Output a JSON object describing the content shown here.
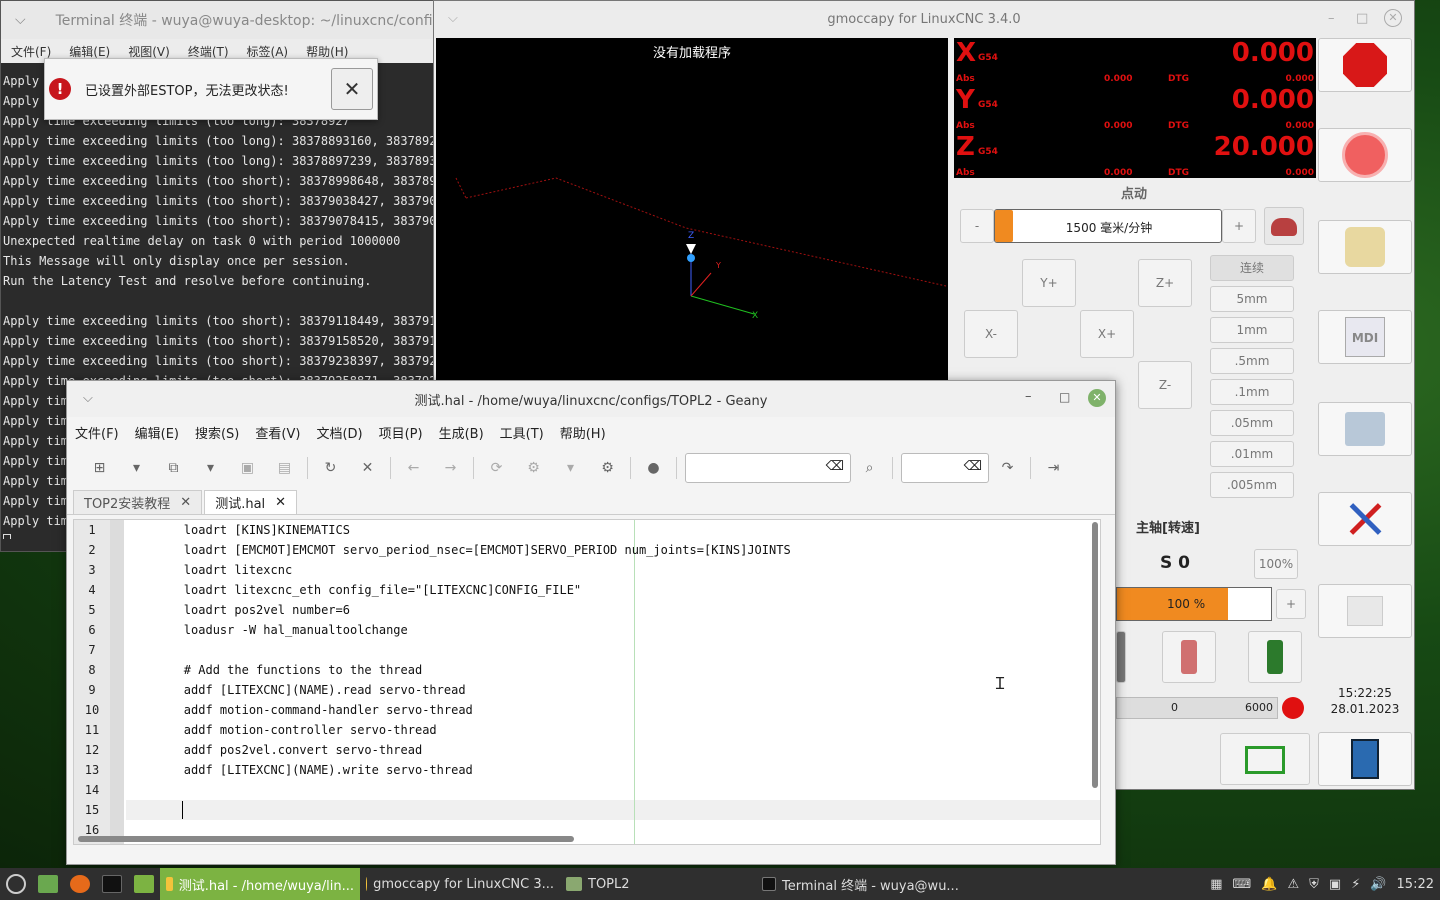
{
  "terminal": {
    "title": "Terminal 终端 - wuya@wuya-desktop: ~/linuxcnc/configs/TO",
    "menu": [
      "文件(F)",
      "编辑(E)",
      "视图(V)",
      "终端(T)",
      "标签(A)",
      "帮助(H)"
    ],
    "lines": [
      "Apply time exceeding limits (too long): 38378923",
      "Apply time exceeding limits (too long): 38378925",
      "Apply time exceeding limits (too long): 38378927",
      "Apply time exceeding limits (too long): 38378893160, 38378929",
      "Apply time exceeding limits (too long): 38378897239, 38378934",
      "Apply time exceeding limits (too short): 38378998648, 38378993",
      "Apply time exceeding limits (too short): 38379038427, 38379033",
      "Apply time exceeding limits (too short): 38379078415, 38379073",
      "Unexpected realtime delay on task 0 with period 1000000",
      "This Message will only display once per session.",
      "Run the Latency Test and resolve before continuing.",
      "",
      "Apply time exceeding limits (too short): 38379118449, 38379113",
      "Apply time exceeding limits (too short): 38379158520, 38379153",
      "Apply time exceeding limits (too short): 38379238397, 38379233",
      "Apply time exceeding limits (too short): 38379258871, 38379253",
      "Apply tim",
      "Apply tim",
      "Apply tim",
      "Apply tim",
      "Apply tim",
      "Apply tim",
      "Apply tim"
    ]
  },
  "alert": {
    "message": "已设置外部ESTOP，无法更改状态!",
    "icon": "error-icon",
    "close": "✕"
  },
  "gmoccapy": {
    "title": "gmoccapy for LinuxCNC  3.4.0",
    "preview_label": "没有加载程序",
    "dro": [
      {
        "axis": "X",
        "coord": "G54",
        "value": "0.000",
        "abs_label": "Abs",
        "abs": "0.000",
        "dtg_label": "DTG",
        "dtg": "0.000"
      },
      {
        "axis": "Y",
        "coord": "G54",
        "value": "0.000",
        "abs_label": "Abs",
        "abs": "0.000",
        "dtg_label": "DTG",
        "dtg": "0.000"
      },
      {
        "axis": "Z",
        "coord": "G54",
        "value": "20.000",
        "abs_label": "Abs",
        "abs": "0.000",
        "dtg_label": "DTG",
        "dtg": "0.000"
      }
    ],
    "jog": {
      "title": "点动",
      "minus": "-",
      "plus": "+",
      "speed": "1500 毫米/分钟",
      "speed_fraction": 0.08,
      "buttons": {
        "yp": "Y+",
        "zp": "Z+",
        "xm": "X-",
        "xp": "X+",
        "zm": "Z-"
      },
      "increments": [
        "连续",
        "5mm",
        "1mm",
        ".5mm",
        ".1mm",
        ".05mm",
        ".01mm",
        ".005mm"
      ]
    },
    "spindle": {
      "title": "主轴[转速]",
      "speed": "S 0",
      "override_btn": "100%",
      "override": "100 %",
      "override_fraction": 0.72,
      "plus": "+",
      "min": "0",
      "max": "6000"
    },
    "clock": {
      "time": "15:22:25",
      "date": "28.01.2023"
    },
    "accent": "#e01010"
  },
  "geany": {
    "title": "测试.hal - /home/wuya/linuxcnc/configs/TOPL2 - Geany",
    "menu": [
      "文件(F)",
      "编辑(E)",
      "搜索(S)",
      "查看(V)",
      "文档(D)",
      "项目(P)",
      "生成(B)",
      "工具(T)",
      "帮助(H)"
    ],
    "tabs": [
      {
        "label": "TOP2安装教程",
        "active": false
      },
      {
        "label": "测试.hal",
        "active": true
      }
    ],
    "code": [
      "        loadrt [KINS]KINEMATICS",
      "        loadrt [EMCMOT]EMCMOT servo_period_nsec=[EMCMOT]SERVO_PERIOD num_joints=[KINS]JOINTS",
      "        loadrt litexcnc",
      "        loadrt litexcnc_eth config_file=\"[LITEXCNC]CONFIG_FILE\"",
      "        loadrt pos2vel number=6",
      "        loadusr -W hal_manualtoolchange",
      "",
      "        # Add the functions to the thread",
      "        addf [LITEXCNC](NAME).read servo-thread",
      "        addf motion-command-handler servo-thread",
      "        addf motion-controller servo-thread",
      "        addf pos2vel.convert servo-thread",
      "        addf [LITEXCNC](NAME).write servo-thread",
      "",
      "        ",
      ""
    ]
  },
  "taskbar": {
    "items": [
      {
        "label": "测试.hal - /home/wuya/lin..."
      },
      {
        "label": "gmoccapy for LinuxCNC 3..."
      },
      {
        "label": "TOPL2"
      },
      {
        "label": "Terminal 终端 - wuya@wu..."
      }
    ],
    "clock": "15:22"
  }
}
